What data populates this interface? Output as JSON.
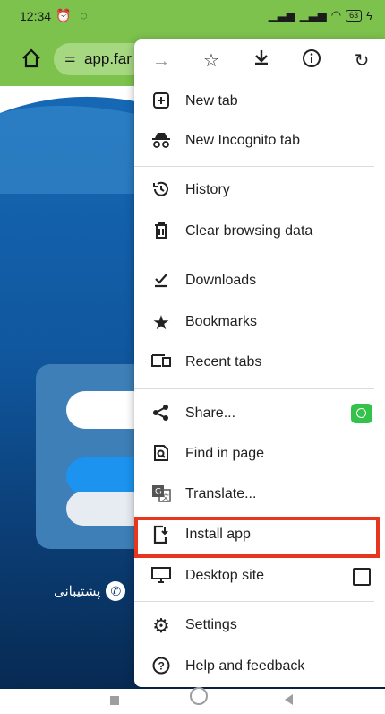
{
  "status_bar": {
    "time": "12:34",
    "battery": "63"
  },
  "url_bar": {
    "url_text": "app.far"
  },
  "page": {
    "support_text": "پشتیبانی"
  },
  "menu": {
    "toolbar": {
      "icons": [
        "forward-icon",
        "bookmark-star-icon",
        "download-icon",
        "info-icon",
        "refresh-icon"
      ]
    },
    "items": [
      {
        "label": "New tab",
        "icon": "new-tab-icon"
      },
      {
        "label": "New Incognito tab",
        "icon": "incognito-icon"
      },
      {
        "label": "History",
        "icon": "history-icon"
      },
      {
        "label": "Clear browsing data",
        "icon": "trash-icon"
      },
      {
        "label": "Downloads",
        "icon": "downloads-icon"
      },
      {
        "label": "Bookmarks",
        "icon": "star-icon"
      },
      {
        "label": "Recent tabs",
        "icon": "recent-tabs-icon"
      },
      {
        "label": "Share...",
        "icon": "share-icon"
      },
      {
        "label": "Find in page",
        "icon": "find-icon"
      },
      {
        "label": "Translate...",
        "icon": "translate-icon"
      },
      {
        "label": "Install app",
        "icon": "install-app-icon"
      },
      {
        "label": "Desktop site",
        "icon": "desktop-icon"
      },
      {
        "label": "Settings",
        "icon": "gear-icon"
      },
      {
        "label": "Help and feedback",
        "icon": "help-icon"
      }
    ],
    "highlight_color": "#e8351d"
  },
  "colors": {
    "browser_bar": "#7cc24d",
    "page_blue": "#1669b6"
  }
}
